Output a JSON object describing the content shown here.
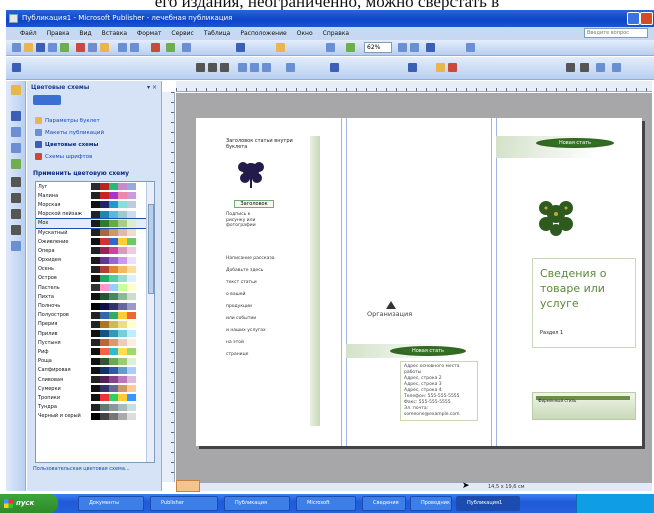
{
  "caption": {
    "text": "его издания, неограниченно, можно сверстать в"
  },
  "window": {
    "title": "Публикация1 - Microsoft Publisher - лечебная публикация"
  },
  "menu": {
    "items": [
      "Файл",
      "Правка",
      "Вид",
      "Вставка",
      "Формат",
      "Сервис",
      "Таблица",
      "Расположение",
      "Окно",
      "Справка"
    ],
    "help_placeholder": "Введите вопрос"
  },
  "toolbar": {
    "zoom": "62%"
  },
  "taskpane": {
    "title": "Цветовые схемы",
    "close": "▾ ×",
    "links": [
      "Параметры буклет",
      "Макеты публикаций",
      "Цветовые схемы",
      "Схемы шрифтов"
    ],
    "section_title": "Применить цветовую схему",
    "schemes": [
      {
        "name": "Луг",
        "colors": [
          "#2b2b2b",
          "#b22",
          "#2b7",
          "#c8c",
          "#9ad"
        ]
      },
      {
        "name": "Малина",
        "colors": [
          "#222",
          "#c22",
          "#a3c",
          "#e8a",
          "#c9d"
        ]
      },
      {
        "name": "Морская",
        "colors": [
          "#111",
          "#226",
          "#29c",
          "#8dd",
          "#bcd"
        ]
      },
      {
        "name": "Морской пейзаж",
        "colors": [
          "#222",
          "#28a",
          "#5bd",
          "#9cc",
          "#cde"
        ]
      },
      {
        "name": "Мох",
        "colors": [
          "#1a1a1a",
          "#373",
          "#6a4",
          "#ac8",
          "#dec"
        ]
      },
      {
        "name": "Мускатный",
        "colors": [
          "#222",
          "#a64",
          "#c96",
          "#dba",
          "#edc"
        ]
      },
      {
        "name": "Оживление",
        "colors": [
          "#111",
          "#c33",
          "#36c",
          "#fc3",
          "#6c6"
        ]
      },
      {
        "name": "Опера",
        "colors": [
          "#222",
          "#925",
          "#c49",
          "#d9b",
          "#ecd"
        ]
      },
      {
        "name": "Орхидея",
        "colors": [
          "#1a1a1a",
          "#639",
          "#96c",
          "#c9e",
          "#edf"
        ]
      },
      {
        "name": "Осень",
        "colors": [
          "#222",
          "#a43",
          "#d83",
          "#eb6",
          "#fd9"
        ]
      },
      {
        "name": "Остров",
        "colors": [
          "#111",
          "#2a6",
          "#5c9",
          "#9dc",
          "#def"
        ]
      },
      {
        "name": "Пастель",
        "colors": [
          "#333",
          "#f9c",
          "#9cf",
          "#cf9",
          "#ffc"
        ]
      },
      {
        "name": "Пихта",
        "colors": [
          "#111",
          "#253",
          "#486",
          "#8b9",
          "#cdc"
        ]
      },
      {
        "name": "Полночь",
        "colors": [
          "#000",
          "#114",
          "#336",
          "#669",
          "#99c"
        ]
      },
      {
        "name": "Полуостров",
        "colors": [
          "#222",
          "#36a",
          "#3a6",
          "#fc3",
          "#e63"
        ]
      },
      {
        "name": "Прерия",
        "colors": [
          "#222",
          "#a72",
          "#cb5",
          "#ed8",
          "#ffc"
        ]
      },
      {
        "name": "Прилив",
        "colors": [
          "#111",
          "#158",
          "#39b",
          "#7cd",
          "#bef"
        ]
      },
      {
        "name": "Пустыня",
        "colors": [
          "#222",
          "#b63",
          "#d96",
          "#ecb",
          "#fed"
        ]
      },
      {
        "name": "Риф",
        "colors": [
          "#111",
          "#e64",
          "#3bc",
          "#fd5",
          "#9d6"
        ]
      },
      {
        "name": "Роща",
        "colors": [
          "#111",
          "#353",
          "#6a5",
          "#9c7",
          "#ded"
        ]
      },
      {
        "name": "Сапфировая",
        "colors": [
          "#111",
          "#136",
          "#35a",
          "#69c",
          "#acf"
        ]
      },
      {
        "name": "Сливовая",
        "colors": [
          "#222",
          "#525",
          "#848",
          "#b7b",
          "#dbd"
        ]
      },
      {
        "name": "Сумерки",
        "colors": [
          "#111",
          "#336",
          "#669",
          "#c96",
          "#fc9"
        ]
      },
      {
        "name": "Тропики",
        "colors": [
          "#111",
          "#e33",
          "#3c6",
          "#fc3",
          "#39f"
        ]
      },
      {
        "name": "Тундра",
        "colors": [
          "#222",
          "#677",
          "#899",
          "#abb",
          "#cdd"
        ]
      },
      {
        "name": "Черный и серый",
        "colors": [
          "#000",
          "#444",
          "#777",
          "#aaa",
          "#ddd"
        ]
      }
    ],
    "selected_index": 4,
    "bottom_link": "Пользовательская цветовая схема..."
  },
  "page": {
    "p1_heading": "Заголовок статьи внутри буклета",
    "photo_caption": "Заголовок",
    "p1_small": "Подпись к рисунку или фотографии",
    "p1_body": [
      "Написание рассказа",
      "Добавьте здесь",
      "текст статьи",
      "о вашей",
      "продукции",
      "или событии",
      "и наших услугах",
      "на этой",
      "странице"
    ],
    "org_name": "Организация",
    "p2_banner": "Новая стать",
    "p2_addr": [
      "Адрес основного места работы",
      "Адрес, строка 2",
      "Адрес, строка 3",
      "Адрес, строка 4",
      "Телефон: 555-555-5555",
      "Факс: 555-555-5555",
      "Эл. почта: someone@example.com"
    ],
    "p3_banner": "Новая стать",
    "product_title": "Сведения о товаре или услуге",
    "product_sub": "Раздел 1",
    "p3_line": "Фирменный стиль"
  },
  "status": {
    "coords": "14,5 x 19,6 см"
  },
  "taskbar": {
    "start_label": "пуск",
    "buttons": [
      "Документы",
      "Publisher",
      "Публикация",
      "Microsoft",
      "Сведения",
      "Проводник",
      "Публикация1"
    ],
    "active_index": 6
  },
  "colors": {
    "title_blue": "#0c45c7",
    "ribbon_blue": "#c7d8f2",
    "workspace_gray": "#a7a7a9",
    "brand_green": "#3a7a2a"
  }
}
